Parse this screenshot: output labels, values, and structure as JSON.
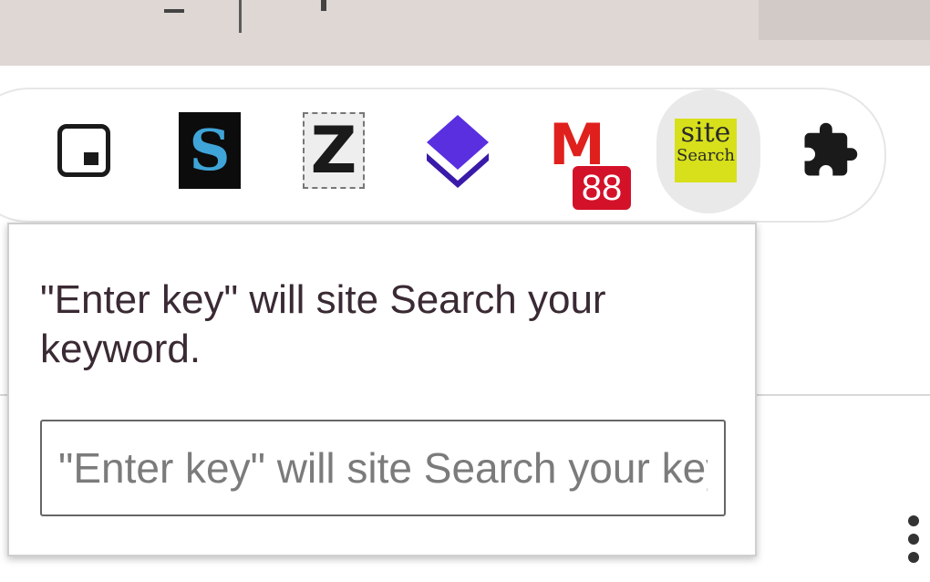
{
  "browser": {
    "extensions": [
      {
        "name": "picture-in-picture",
        "icon": "pip-icon"
      },
      {
        "name": "sm-extension",
        "icon": "sm-logo-icon",
        "glyph": "S"
      },
      {
        "name": "z-extension",
        "icon": "z-logo-icon",
        "glyph": "Z"
      },
      {
        "name": "layers-extension",
        "icon": "layers-icon"
      },
      {
        "name": "gmail-checker",
        "icon": "gmail-icon",
        "glyph": "M",
        "badge": "88"
      },
      {
        "name": "site-search",
        "icon": "site-search-icon",
        "line1": "site",
        "line2": "Search"
      },
      {
        "name": "extensions-menu",
        "icon": "puzzle-icon"
      }
    ]
  },
  "popup": {
    "message": "\"Enter key\" will site Search your keyword.",
    "input_placeholder": "\"Enter key\" will site Search your keyword."
  },
  "colors": {
    "tabstrip": "#ded7d3",
    "gmail_red": "#d3122a",
    "site_yellow": "#d7e01a",
    "layers_purple": "#4a23c8"
  }
}
